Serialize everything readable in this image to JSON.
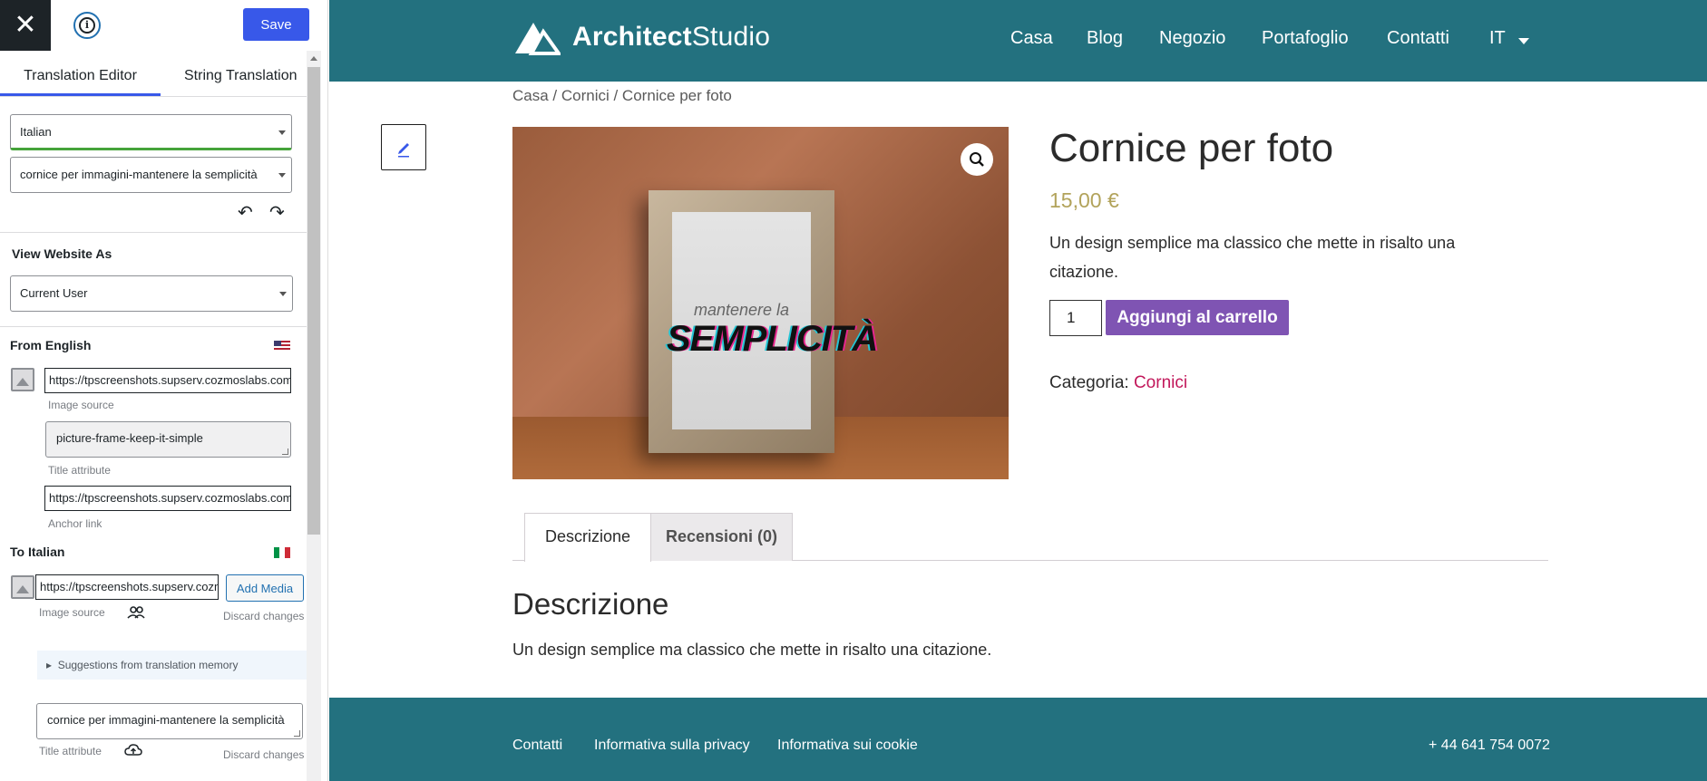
{
  "sidebar": {
    "close_label": "✕",
    "save_label": "Save",
    "tabs": [
      {
        "label": "Translation Editor"
      },
      {
        "label": "String Translation"
      }
    ],
    "language_select": "Italian",
    "string_select": "cornice per immagini-mantenere la semplicità",
    "view_as_title": "View Website As",
    "view_as_select": "Current User",
    "from_title": "From English",
    "from_image_source": "https://tpscreenshots.supserv.cozmoslabs.com/wp-content/uploads/2021/09/picture-frame-keep-it-simple.jpg",
    "from_image_source_hint": "Image source",
    "from_title_attr": "picture-frame-keep-it-simple",
    "from_title_attr_hint": "Title attribute",
    "from_anchor": "https://tpscreenshots.supserv.cozmoslabs.com/wp-content/uploads/2021/09/picture-frame-keep-it-simple.jpg",
    "from_anchor_hint": "Anchor link",
    "to_title": "To Italian",
    "to_image_source": "https://tpscreenshots.supserv.cozmoslabs.com/wp-content/uploads/2021/09/cornice.jpg",
    "add_media_label": "Add Media",
    "to_image_source_hint": "Image source",
    "discard_label": "Discard changes",
    "suggestions_label": "Suggestions from translation memory",
    "to_title_attr": "cornice per immagini-mantenere la semplicità",
    "to_title_attr_hint": "Title attribute"
  },
  "site": {
    "logo_bold": "Architect",
    "logo_light": "Studio",
    "nav": [
      "Casa",
      "Blog",
      "Negozio",
      "Portafoglio",
      "Contatti",
      "IT"
    ],
    "breadcrumb": "Casa / Cornici / Cornice per foto",
    "image_text_1": "mantenere la",
    "image_text_2": "SEMPLICITÀ",
    "product_title": "Cornice per foto",
    "product_price": "15,00 €",
    "product_desc": "Un design semplice ma classico che mette in risalto una citazione.",
    "qty": "1",
    "cart_label": "Aggiungi al carrello",
    "category_label": "Categoria:",
    "category_value": "Cornici",
    "tab_desc": "Descrizione",
    "tab_reviews": "Recensioni (0)",
    "desc_heading": "Descrizione",
    "desc_text": "Un design semplice ma classico che mette in risalto una citazione.",
    "footer_links": [
      "Contatti",
      "Informativa sulla privacy",
      "Informativa sui cookie"
    ],
    "footer_phone": "+ 44 641 754 0072"
  },
  "colors": {
    "header_bg": "#23717f",
    "accent_blue": "#3858e9",
    "cart_purple": "#7f54b3",
    "price_gold": "#b2a35b",
    "link_pink": "#c2185b"
  },
  "icons": [
    "close-icon",
    "info-icon",
    "undo-icon",
    "redo-icon",
    "image-placeholder-icon",
    "us-flag-icon",
    "it-flag-icon",
    "people-icon",
    "cloud-upload-icon",
    "pencil-icon",
    "zoom-icon",
    "chevron-down-icon"
  ]
}
